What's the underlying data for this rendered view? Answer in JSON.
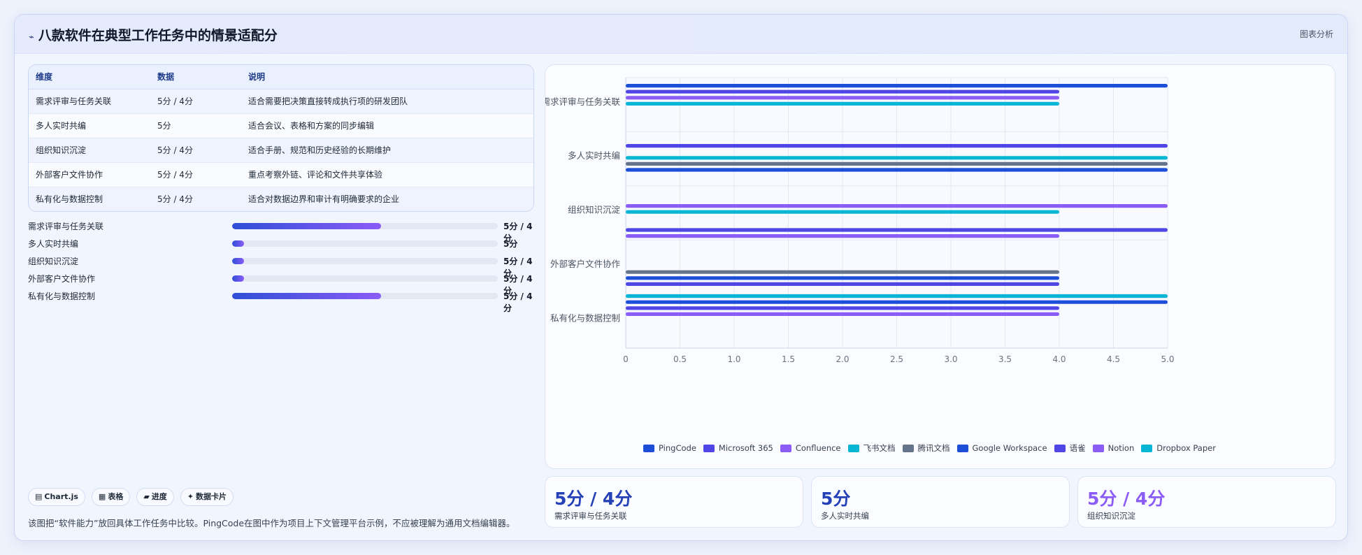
{
  "header": {
    "icon": "⌁",
    "title": "八款软件在典型工作任务中的情景适配分",
    "right_label": "图表分析"
  },
  "table": {
    "headers": [
      "维度",
      "数据",
      "说明"
    ],
    "rows": [
      [
        "需求评审与任务关联",
        "5分 / 4分",
        "适合需要把决策直接转成执行项的研发团队"
      ],
      [
        "多人实时共编",
        "5分",
        "适合会议、表格和方案的同步编辑"
      ],
      [
        "组织知识沉淀",
        "5分 / 4分",
        "适合手册、规范和历史经验的长期维护"
      ],
      [
        "外部客户文件协作",
        "5分 / 4分",
        "重点考察外链、评论和文件共享体验"
      ],
      [
        "私有化与数据控制",
        "5分 / 4分",
        "适合对数据边界和审计有明确要求的企业"
      ]
    ]
  },
  "progress": [
    {
      "label": "需求评审与任务关联",
      "value": "5分 / 4分",
      "fill": 0.56
    },
    {
      "label": "多人实时共编",
      "value": "5分",
      "fill": 0.045
    },
    {
      "label": "组织知识沉淀",
      "value": "5分 / 4分",
      "fill": 0.045
    },
    {
      "label": "外部客户文件协作",
      "value": "5分 / 4分",
      "fill": 0.045
    },
    {
      "label": "私有化与数据控制",
      "value": "5分 / 4分",
      "fill": 0.56
    }
  ],
  "chips": [
    {
      "icon": "▤",
      "label": "Chart.js"
    },
    {
      "icon": "▦",
      "label": "表格"
    },
    {
      "icon": "▰",
      "label": "进度"
    },
    {
      "icon": "✦",
      "label": "数据卡片"
    }
  ],
  "note": "该图把“软件能力”放回具体工作任务中比较。PingCode在图中作为项目上下文管理平台示例，不应被理解为通用文档编辑器。",
  "stats": [
    {
      "value": "5分 / 4分",
      "label": "需求评审与任务关联",
      "color": "#2541b8"
    },
    {
      "value": "5分",
      "label": "多人实时共编",
      "color": "#2541b8"
    },
    {
      "value": "5分 / 4分",
      "label": "组织知识沉淀",
      "color": "#8b5cf6"
    }
  ],
  "chart_data": {
    "type": "bar",
    "orientation": "horizontal",
    "categories": [
      "需求评审与任务关联",
      "多人实时共编",
      "组织知识沉淀",
      "外部客户文件协作",
      "私有化与数据控制"
    ],
    "xlim": [
      0,
      5
    ],
    "xticks": [
      "0",
      "0.5",
      "1.0",
      "1.5",
      "2.0",
      "2.5",
      "3.0",
      "3.5",
      "4.0",
      "4.5",
      "5.0"
    ],
    "grid": true,
    "legend_position": "bottom",
    "series": [
      {
        "name": "PingCode",
        "color": "#1d4ed8",
        "values": [
          5,
          null,
          null,
          null,
          5
        ]
      },
      {
        "name": "Microsoft 365",
        "color": "#4f46e5",
        "values": [
          4,
          5,
          null,
          null,
          4
        ]
      },
      {
        "name": "Confluence",
        "color": "#8b5cf6",
        "values": [
          4,
          null,
          5,
          null,
          4
        ]
      },
      {
        "name": "飞书文档",
        "color": "#06b6d4",
        "values": [
          4,
          5,
          4,
          null,
          null
        ]
      },
      {
        "name": "腾讯文档",
        "color": "#64748b",
        "values": [
          null,
          5,
          null,
          4,
          null
        ]
      },
      {
        "name": "Google Workspace",
        "color": "#1d4ed8",
        "values": [
          null,
          5,
          null,
          4,
          null
        ]
      },
      {
        "name": "语雀",
        "color": "#4f46e5",
        "values": [
          null,
          null,
          5,
          4,
          null
        ]
      },
      {
        "name": "Notion",
        "color": "#8b5cf6",
        "values": [
          null,
          null,
          4,
          null,
          null
        ]
      },
      {
        "name": "Dropbox Paper",
        "color": "#06b6d4",
        "values": [
          null,
          null,
          null,
          5,
          null
        ]
      }
    ]
  }
}
